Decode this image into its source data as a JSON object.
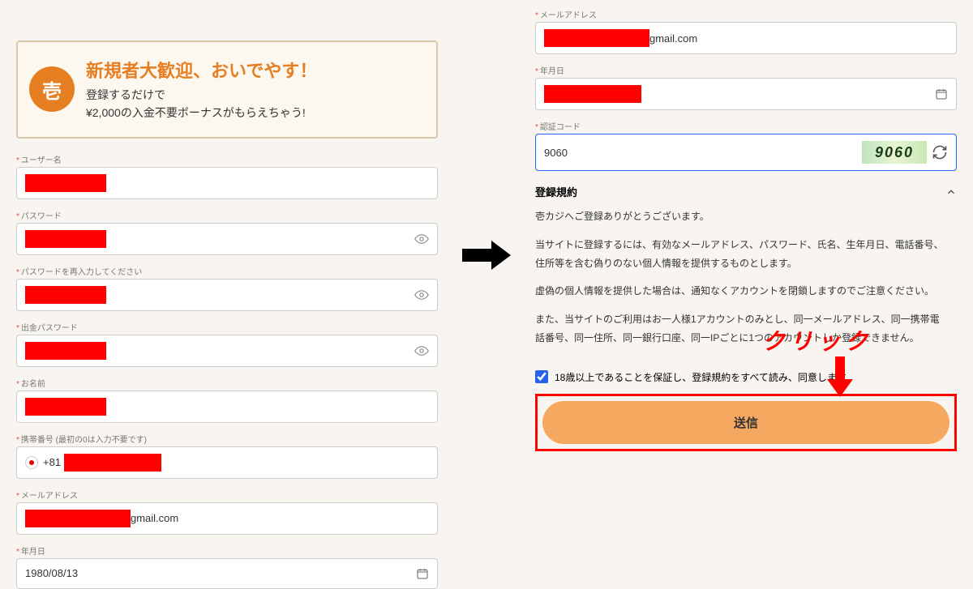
{
  "banner": {
    "logo_char": "壱",
    "title": "新規者大歓迎、おいでやす！",
    "line1": "登録するだけで",
    "line2": "¥2,000の入金不要ボーナスがもらえちゃう!"
  },
  "labels": {
    "username": "ユーザー名",
    "password": "パスワード",
    "password_confirm": "パスワードを再入力してください",
    "withdraw_password": "出金パスワード",
    "name": "お名前",
    "phone": "携帯番号 (最初の0は入力不要です)",
    "email": "メールアドレス",
    "birthdate": "年月日",
    "verify_code": "認証コード"
  },
  "values": {
    "phone_prefix": "+81",
    "email_suffix": "gmail.com",
    "birthdate": "1980/08/13",
    "verify_code": "9060",
    "captcha_display": "9060"
  },
  "terms": {
    "header": "登録規約",
    "p1": "壱カジへご登録ありがとうございます。",
    "p2": "当サイトに登録するには、有効なメールアドレス、パスワード、氏名、生年月日、電話番号、住所等を含む偽りのない個人情報を提供するものとします。",
    "p3": "虚偽の個人情報を提供した場合は、通知なくアカウントを閉鎖しますのでご注意ください。",
    "p4": "また、当サイトのご利用はお一人様1アカウントのみとし、同一メールアドレス、同一携帯電話番号、同一住所、同一銀行口座、同一IPごとに1つのアカウントしか登録できません。"
  },
  "agree_label": "18歳以上であることを保証し、登録規約をすべて読み、同意します",
  "submit_label": "送信",
  "overlay_text": "クリック",
  "req_mark": "*"
}
